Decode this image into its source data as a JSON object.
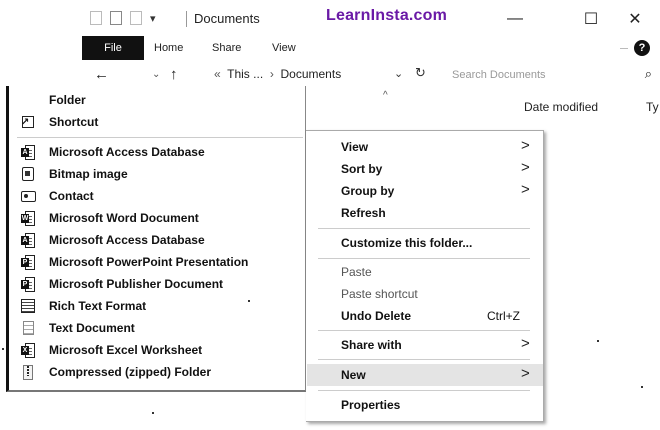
{
  "window": {
    "title": "Documents",
    "brand": "LearnInsta.com",
    "controls": {
      "minimize": "—",
      "maximize": "☐",
      "close": "✕"
    }
  },
  "ribbon": {
    "tabs": [
      "File",
      "Home",
      "Share",
      "View"
    ],
    "help": "?"
  },
  "address": {
    "back": "←",
    "forward": "⌄",
    "up": "↑",
    "overflow": "«",
    "crumbs": [
      "This ...",
      "Documents"
    ],
    "crumb_sep": "›",
    "dropdown": "⌄",
    "refresh": "↻",
    "search_placeholder": "Search Documents",
    "search_icon": "⌕"
  },
  "columns": {
    "sort_caret": "^",
    "date_modified": "Date modified",
    "type": "Ty"
  },
  "new_submenu": {
    "items": [
      {
        "label": "Folder",
        "icon": "folder-icon"
      },
      {
        "label": "Shortcut",
        "icon": "shortcut-icon"
      },
      {
        "label": "Microsoft Access Database",
        "icon": "access-icon"
      },
      {
        "label": "Bitmap image",
        "icon": "bitmap-icon"
      },
      {
        "label": "Contact",
        "icon": "contact-icon"
      },
      {
        "label": "Microsoft Word Document",
        "icon": "word-icon"
      },
      {
        "label": "Microsoft Access Database",
        "icon": "access-icon"
      },
      {
        "label": "Microsoft PowerPoint Presentation",
        "icon": "powerpoint-icon"
      },
      {
        "label": "Microsoft Publisher Document",
        "icon": "publisher-icon"
      },
      {
        "label": "Rich Text Format",
        "icon": "rtf-icon"
      },
      {
        "label": "Text Document",
        "icon": "text-document-icon"
      },
      {
        "label": "Microsoft Excel Worksheet",
        "icon": "excel-icon"
      },
      {
        "label": "Compressed (zipped) Folder",
        "icon": "zip-folder-icon"
      }
    ]
  },
  "context_menu": {
    "items": [
      {
        "label": "View",
        "submenu": true
      },
      {
        "label": "Sort by",
        "submenu": true
      },
      {
        "label": "Group by",
        "submenu": true
      },
      {
        "label": "Refresh"
      },
      {
        "label": "Customize this folder..."
      },
      {
        "label": "Paste",
        "disabled": true
      },
      {
        "label": "Paste shortcut",
        "disabled": true
      },
      {
        "label": "Undo Delete",
        "shortcut": "Ctrl+Z"
      },
      {
        "label": "Share with",
        "submenu": true
      },
      {
        "label": "New",
        "submenu": true,
        "highlighted": true
      },
      {
        "label": "Properties"
      }
    ],
    "arrow": ">"
  }
}
